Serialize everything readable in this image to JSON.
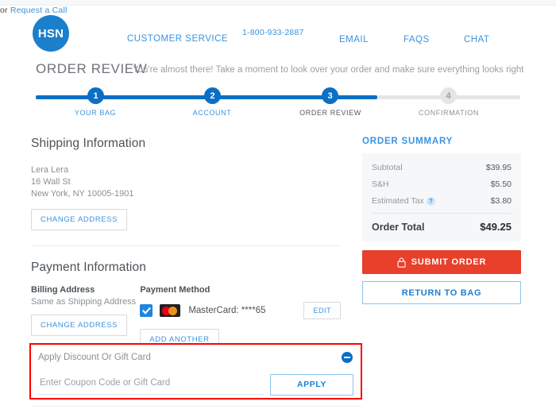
{
  "header": {
    "logo_text": "HSN",
    "customer_service": "CUSTOMER SERVICE",
    "phone": "1-800-933-2887",
    "request_prefix": "or ",
    "request_link": "Request a Call",
    "email": "EMAIL",
    "faqs": "FAQS",
    "chat": "CHAT"
  },
  "page": {
    "title": "ORDER REVIEW",
    "subtitle": "You're almost there! Take a moment to look over your order and make sure everything looks right"
  },
  "stepper": {
    "steps": [
      {
        "number": "1",
        "label": "YOUR BAG",
        "state": "done"
      },
      {
        "number": "2",
        "label": "ACCOUNT",
        "state": "done"
      },
      {
        "number": "3",
        "label": "ORDER REVIEW",
        "state": "current"
      },
      {
        "number": "4",
        "label": "CONFIRMATION",
        "state": "todo"
      }
    ]
  },
  "shipping": {
    "heading": "Shipping Information",
    "name": "Lera Lera",
    "street": "16 Wall St",
    "city_state_zip": "New York, NY 10005-1901",
    "change_button": "CHANGE ADDRESS"
  },
  "payment": {
    "heading": "Payment Information",
    "billing_label": "Billing Address",
    "billing_value": "Same as Shipping Address",
    "change_button": "CHANGE ADDRESS",
    "method_label": "Payment Method",
    "card_text": "MasterCard: ****65",
    "card_brand": "mastercard-logo",
    "edit_button": "EDIT",
    "add_another_button": "ADD ANOTHER"
  },
  "summary": {
    "title": "ORDER SUMMARY",
    "rows": [
      {
        "label": "Subtotal",
        "value": "$39.95"
      },
      {
        "label": "S&H",
        "value": "$5.50"
      },
      {
        "label": "Estimated Tax",
        "value": "$3.80",
        "help": "?"
      }
    ],
    "total_label": "Order Total",
    "total_value": "$49.25",
    "submit_button": "SUBMIT ORDER",
    "return_button": "RETURN TO BAG"
  },
  "coupon": {
    "heading": "Apply Discount Or Gift Card",
    "input_value": "",
    "input_placeholder": "Enter Coupon Code or Gift Card",
    "apply_button": "APPLY"
  },
  "colors": {
    "brand_blue": "#1b7fcb",
    "link_blue": "#3b93dd",
    "step_blue": "#0b6fc4",
    "submit_red": "#e8402a",
    "highlight_red": "#ff0000"
  }
}
